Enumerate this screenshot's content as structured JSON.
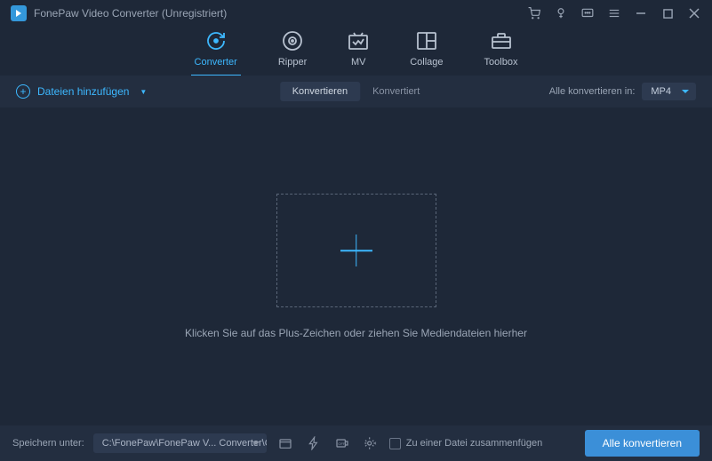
{
  "titlebar": {
    "title": "FonePaw Video Converter (Unregistriert)"
  },
  "tabs": [
    {
      "label": "Converter",
      "active": true
    },
    {
      "label": "Ripper"
    },
    {
      "label": "MV"
    },
    {
      "label": "Collage"
    },
    {
      "label": "Toolbox"
    }
  ],
  "subbar": {
    "add_label": "Dateien hinzufügen",
    "status_converting": "Konvertieren",
    "status_converted": "Konvertiert",
    "convert_all_label": "Alle konvertieren in:",
    "format": "MP4"
  },
  "dropzone": {
    "text": "Klicken Sie auf das Plus-Zeichen oder ziehen Sie Mediendateien hierher"
  },
  "footer": {
    "save_label": "Speichern unter:",
    "path": "C:\\FonePaw\\FonePaw V... Converter\\Converted",
    "merge_label": "Zu einer Datei zusammenfügen",
    "convert_button": "Alle konvertieren"
  }
}
